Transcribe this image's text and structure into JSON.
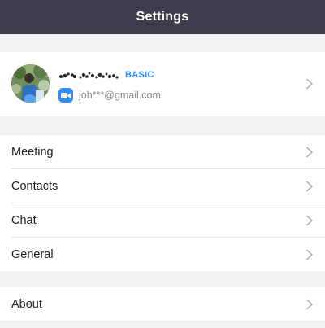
{
  "header": {
    "title": "Settings"
  },
  "profile": {
    "plan": "BASIC",
    "email": "joh***@gmail.com",
    "avatar_icon": "avatar-photo",
    "account_icon": "zoom-video-icon"
  },
  "menu_group_main": [
    {
      "id": "meeting",
      "label": "Meeting"
    },
    {
      "id": "contacts",
      "label": "Contacts"
    },
    {
      "id": "chat",
      "label": "Chat"
    },
    {
      "id": "general",
      "label": "General"
    }
  ],
  "menu_group_about": [
    {
      "id": "about",
      "label": "About"
    }
  ],
  "colors": {
    "header_bg": "#3d3d4c",
    "accent": "#2d8cff",
    "page_bg": "#f2f2f2"
  }
}
